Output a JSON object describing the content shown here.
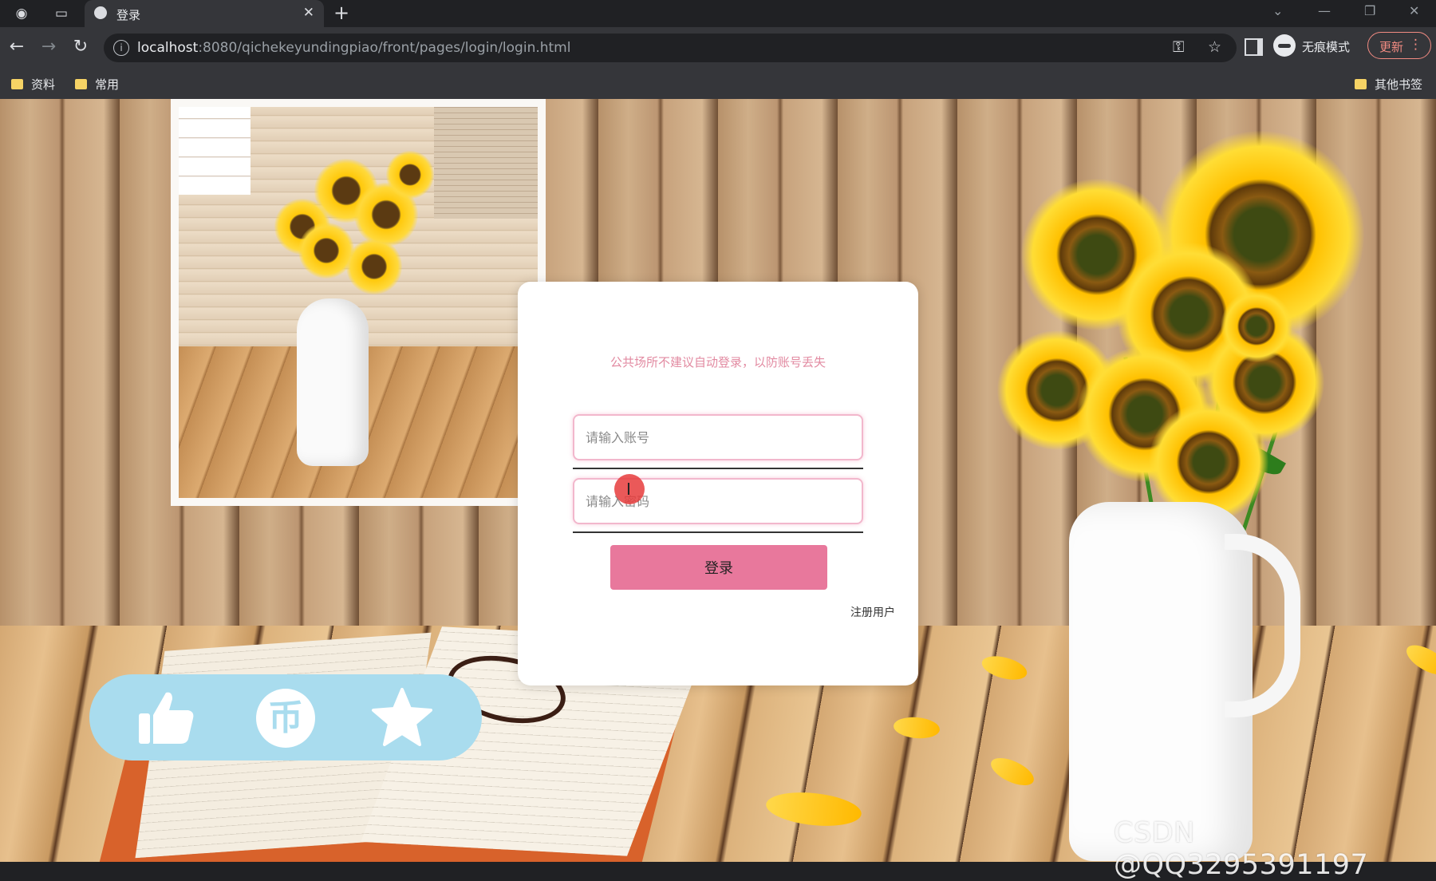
{
  "browser": {
    "tab": {
      "title": "登录"
    },
    "address_bar": {
      "host": "localhost",
      "path": ":8080/qichekeyundingpiao/front/pages/login/login.html"
    },
    "profile_label": "无痕模式",
    "update_label": "更新",
    "bookmarks": [
      {
        "label": "资料"
      },
      {
        "label": "常用"
      }
    ],
    "other_bookmarks_label": "其他书签"
  },
  "login": {
    "notice": "公共场所不建议自动登录，以防账号丢失",
    "username_placeholder": "请输入账号",
    "password_placeholder": "请输入密码",
    "submit_label": "登录",
    "register_label": "注册用户"
  },
  "action_bar": {
    "icons": [
      "thumbs-up-icon",
      "coin-icon",
      "star-icon"
    ],
    "coin_glyph": "币",
    "color": "#a9dcee"
  },
  "watermark": "CSDN @QQ3295391197",
  "colors": {
    "accent_pink": "#e8789c",
    "notice_pink": "#e28aa1",
    "field_border": "#f2b7cc",
    "browser_dark": "#202124",
    "update_red": "#f28b82"
  }
}
